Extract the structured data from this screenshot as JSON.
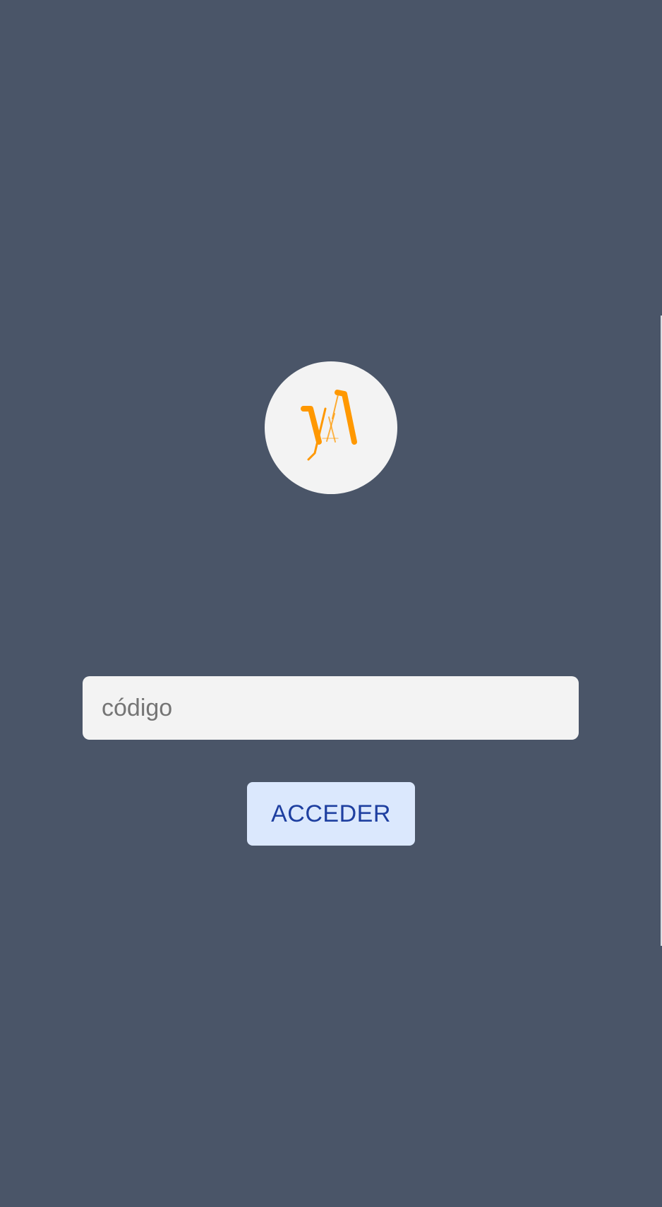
{
  "page": {
    "background_color": "#4a5568"
  },
  "logo": {
    "icon": "va-logo-icon",
    "mark_color": "#ff9800",
    "circle_color": "#f3f3f3"
  },
  "login_form": {
    "code_input": {
      "value": "",
      "placeholder": "código"
    },
    "access_button": {
      "label": "ACCEDER",
      "text_color": "#1e3fa0",
      "background_color": "#dbe8fd"
    }
  }
}
